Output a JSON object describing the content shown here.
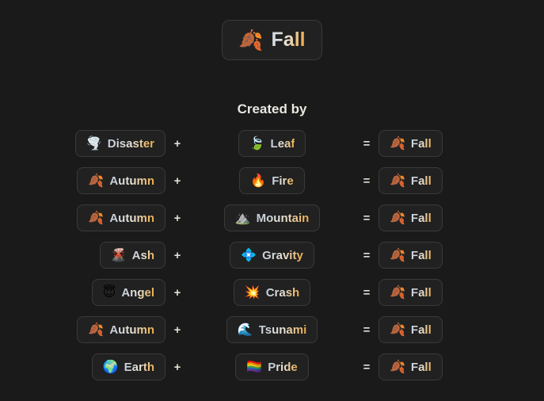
{
  "page": {
    "background_color": "#1a1a1a",
    "pill_background": "#212121",
    "pill_border": "#3a3a3a",
    "accent_color": "#f0a030"
  },
  "header": {
    "emoji": "🍂",
    "emoji_name": "fallen-leaf-icon",
    "title": "Fall"
  },
  "section": {
    "heading": "Created by"
  },
  "operators": {
    "plus": "+",
    "equals": "="
  },
  "recipes": [
    {
      "first": {
        "emoji": "🌪️",
        "emoji_name": "tornado-icon",
        "label": "Disaster"
      },
      "second": {
        "emoji": "🍃",
        "emoji_name": "leaf-icon",
        "label": "Leaf"
      },
      "result": {
        "emoji": "🍂",
        "emoji_name": "fallen-leaf-icon",
        "label": "Fall"
      }
    },
    {
      "first": {
        "emoji": "🍂",
        "emoji_name": "fallen-leaf-icon",
        "label": "Autumn"
      },
      "second": {
        "emoji": "🔥",
        "emoji_name": "fire-icon",
        "label": "Fire"
      },
      "result": {
        "emoji": "🍂",
        "emoji_name": "fallen-leaf-icon",
        "label": "Fall"
      }
    },
    {
      "first": {
        "emoji": "🍂",
        "emoji_name": "fallen-leaf-icon",
        "label": "Autumn"
      },
      "second": {
        "emoji": "⛰️",
        "emoji_name": "mountain-icon",
        "label": "Mountain"
      },
      "result": {
        "emoji": "🍂",
        "emoji_name": "fallen-leaf-icon",
        "label": "Fall"
      }
    },
    {
      "first": {
        "emoji": "🌋",
        "emoji_name": "volcano-icon",
        "label": "Ash"
      },
      "second": {
        "emoji": "💠",
        "emoji_name": "diamond-shape-icon",
        "label": "Gravity"
      },
      "result": {
        "emoji": "🍂",
        "emoji_name": "fallen-leaf-icon",
        "label": "Fall"
      }
    },
    {
      "first": {
        "emoji": "😇",
        "emoji_name": "angel-face-icon",
        "label": "Angel"
      },
      "second": {
        "emoji": "💥",
        "emoji_name": "collision-icon",
        "label": "Crash"
      },
      "result": {
        "emoji": "🍂",
        "emoji_name": "fallen-leaf-icon",
        "label": "Fall"
      }
    },
    {
      "first": {
        "emoji": "🍂",
        "emoji_name": "fallen-leaf-icon",
        "label": "Autumn"
      },
      "second": {
        "emoji": "🌊",
        "emoji_name": "wave-icon",
        "label": "Tsunami"
      },
      "result": {
        "emoji": "🍂",
        "emoji_name": "fallen-leaf-icon",
        "label": "Fall"
      }
    },
    {
      "first": {
        "emoji": "🌍",
        "emoji_name": "earth-globe-icon",
        "label": "Earth"
      },
      "second": {
        "emoji": "🏳️‍🌈",
        "emoji_name": "rainbow-flag-icon",
        "label": "Pride"
      },
      "result": {
        "emoji": "🍂",
        "emoji_name": "fallen-leaf-icon",
        "label": "Fall"
      }
    }
  ]
}
